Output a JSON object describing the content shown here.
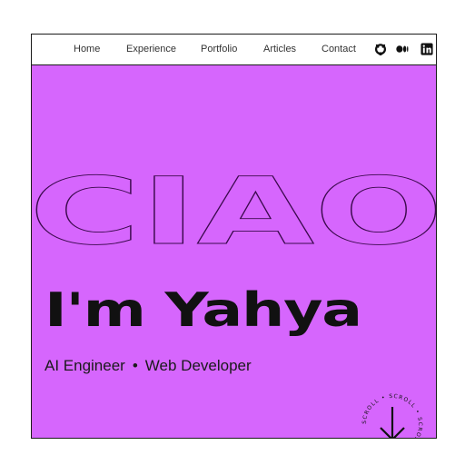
{
  "nav": {
    "links": [
      "Home",
      "Experience",
      "Portfolio",
      "Articles",
      "Contact"
    ],
    "icons": [
      "github-icon",
      "medium-icon",
      "linkedin-icon"
    ]
  },
  "hero": {
    "background": "#d666fd",
    "outline_word": "CIAO",
    "headline": "I'm Yahya",
    "roles": [
      "AI Engineer",
      "Web Developer"
    ],
    "separator": "•",
    "scroll_text": "SCROLL • SCROLL • SCROLL • SCROLL •",
    "scroll_icon": "arrow-down-icon"
  }
}
